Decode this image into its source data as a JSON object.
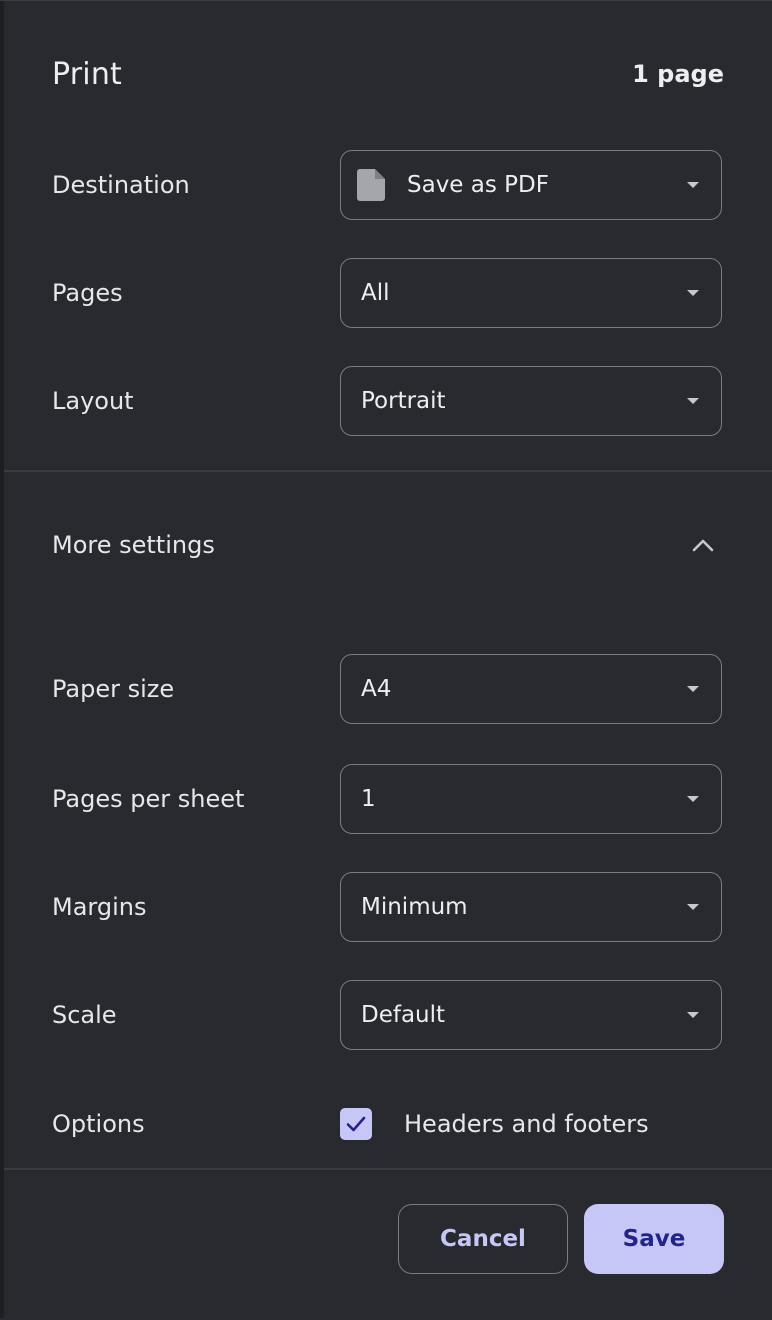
{
  "header": {
    "title": "Print",
    "page_count": "1 page"
  },
  "settings": {
    "destination": {
      "label": "Destination",
      "value": "Save as PDF",
      "icon": "file-icon"
    },
    "pages": {
      "label": "Pages",
      "value": "All"
    },
    "layout": {
      "label": "Layout",
      "value": "Portrait"
    }
  },
  "more_settings": {
    "label": "More settings",
    "expanded": true,
    "icon": "chevron-up-icon",
    "paper_size": {
      "label": "Paper size",
      "value": "A4"
    },
    "pages_per_sheet": {
      "label": "Pages per sheet",
      "value": "1"
    },
    "margins": {
      "label": "Margins",
      "value": "Minimum"
    },
    "scale": {
      "label": "Scale",
      "value": "Default"
    },
    "options": {
      "label": "Options",
      "headers_footers": {
        "label": "Headers and footers",
        "checked": true,
        "icon": "checkmark-icon"
      }
    }
  },
  "footer": {
    "cancel_label": "Cancel",
    "save_label": "Save"
  },
  "colors": {
    "background": "#292a2f",
    "accent": "#c6c7f6",
    "accent_text": "#23248a",
    "border": "#7b7c82",
    "text": "#e8e9ed"
  }
}
